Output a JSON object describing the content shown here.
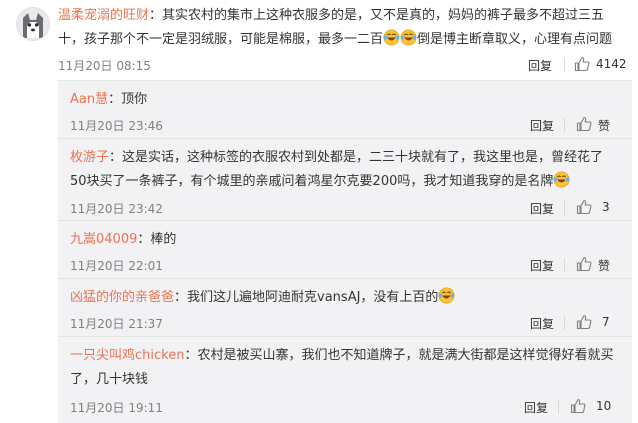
{
  "main": {
    "username": "温柔宠溺的旺财",
    "text_part1": "：其实农村的集市上这种衣服多的是，又不是真的，妈妈的裤子最多不超过三五十，孩子那个不一定是羽绒服，可能是棉服，最多一二百",
    "text_part2": "倒是博主断章取义，心理有点问题",
    "date": "11月20日 08:15",
    "reply_label": "回复",
    "likes": "4142"
  },
  "replies": [
    {
      "username": "Aan慧",
      "text": "：顶你",
      "date": "11月20日 23:46",
      "reply_label": "回复",
      "likes": "赞"
    },
    {
      "username": "枚游子",
      "text": "：这是实话，这种标签的衣服农村到处都是，二三十块就有了，我这里也是，曾经花了50块买了一条裤子，有个城里的亲戚问着鸿星尔克要200吗，我才知道我穿的是名牌",
      "date": "11月20日 23:42",
      "reply_label": "回复",
      "likes": "3"
    },
    {
      "username": "九嵩04009",
      "text": "：棒的",
      "date": "11月20日 22:01",
      "reply_label": "回复",
      "likes": "赞"
    },
    {
      "username": "凶猛的你的亲爸爸",
      "text": "：我们这儿遍地阿迪耐克vansAJ，没有上百的",
      "date": "11月20日 21:37",
      "reply_label": "回复",
      "likes": "7"
    },
    {
      "username": "一只尖叫鸡chicken",
      "text": "：农村是被买山寨，我们也不知道牌子，就是满大街都是这样觉得好看就买了，几十块钱",
      "date": "11月20日 19:11",
      "reply_label": "回复",
      "likes": "10"
    }
  ],
  "icons": {
    "emoji": "laughing-tears-emoji",
    "like": "thumb-up-icon"
  },
  "colors": {
    "username": "#eb7350",
    "reply_bg": "#f2f2f5",
    "meta": "#808080"
  }
}
